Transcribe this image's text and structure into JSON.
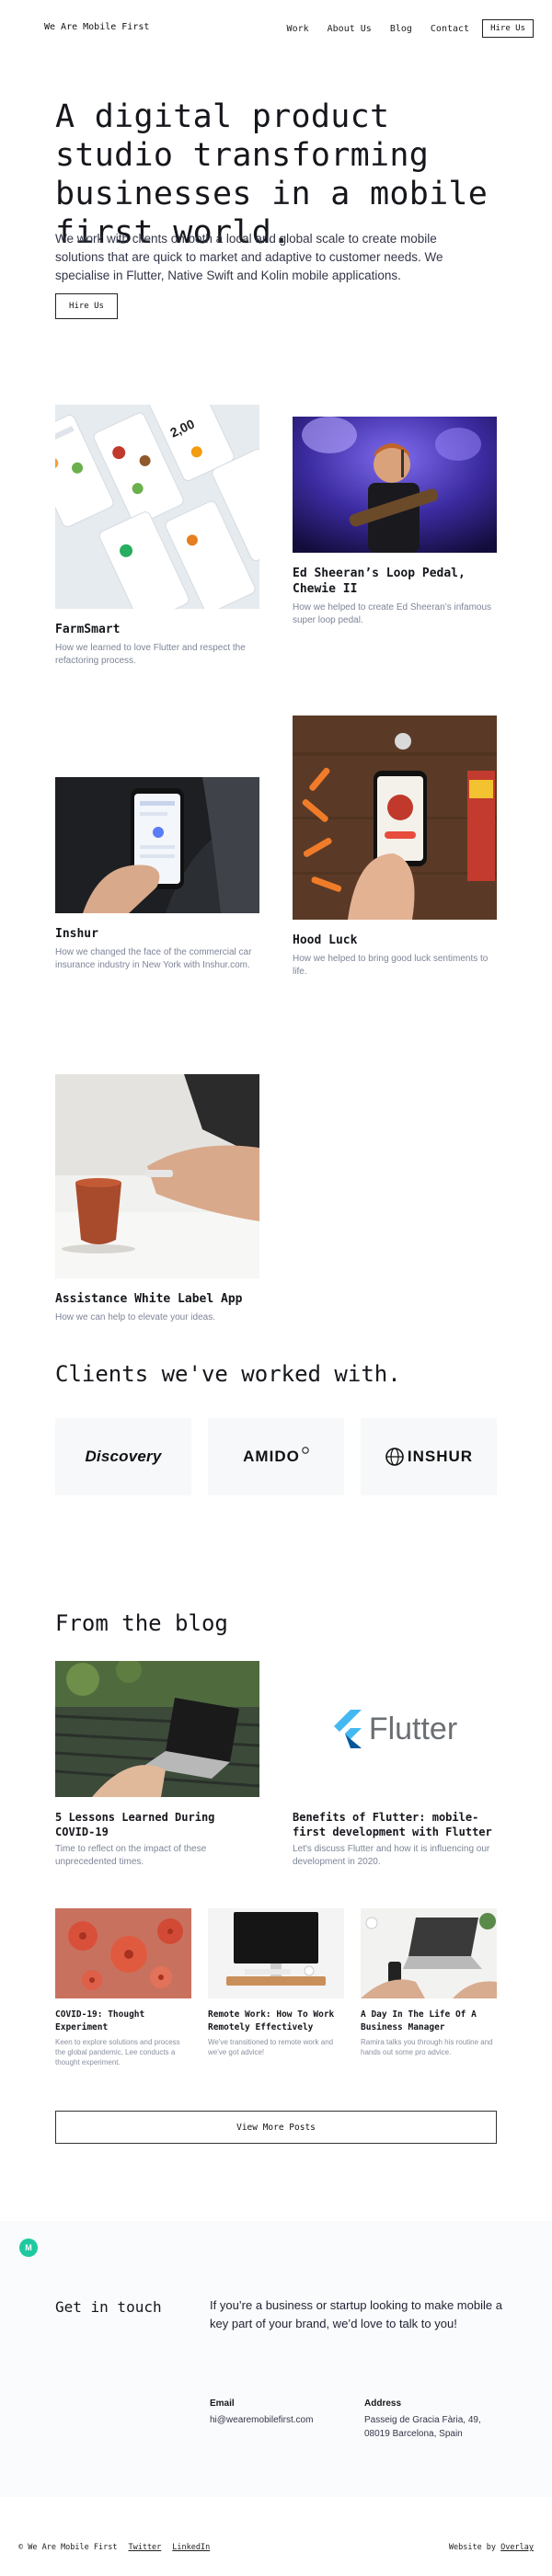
{
  "header": {
    "brand": "We Are Mobile First",
    "nav": [
      "Work",
      "About Us",
      "Blog",
      "Contact"
    ],
    "hire_label": "Hire Us"
  },
  "hero": {
    "title": "A digital product studio transforming businesses in a mobile first world.",
    "text": "We work with clients on both a local and global scale to create mobile solutions that are quick to market and adaptive to customer needs. We specialise in Flutter, Native Swift and Kolin mobile applications.",
    "button": "Hire Us"
  },
  "projects": [
    {
      "title": "FarmSmart",
      "desc": "How we learned to love Flutter and respect the refactoring process."
    },
    {
      "title": "Ed Sheeran’s Loop Pedal, Chewie II",
      "desc": "How we helped to create Ed Sheeran’s infamous super loop pedal."
    },
    {
      "title": "Inshur",
      "desc": "How we changed the face of the commercial car insurance industry in New York with Inshur.com."
    },
    {
      "title": "Hood Luck",
      "desc": "How we helped to bring good luck sentiments to life."
    },
    {
      "title": "Assistance White Label App",
      "desc": "How we can help to elevate your ideas."
    }
  ],
  "clients": {
    "heading": "Clients we've worked with.",
    "logos": [
      "Discovery",
      "AMIDO",
      "INSHUR"
    ]
  },
  "blog": {
    "heading": "From the blog",
    "featured": [
      {
        "title": "5 Lessons Learned During COVID-19",
        "desc": "Time to reflect on the impact of these unprecedented times."
      },
      {
        "title": "Benefits of Flutter: mobile-first development with Flutter",
        "desc": "Let's discuss Flutter and how it is influencing our development in 2020.",
        "logo_text": "Flutter"
      }
    ],
    "posts": [
      {
        "title": "COVID-19: Thought Experiment",
        "desc": "Keen to explore solutions and process the global pandemic, Lee conducts a thought experiment."
      },
      {
        "title": "Remote Work: How To Work Remotely Effectively",
        "desc": "We've transitioned to remote work and we've got advice!"
      },
      {
        "title": "A Day In The Life Of A Business Manager",
        "desc": "Ramira talks you through his routine and hands out some pro advice."
      }
    ],
    "more_label": "View More Posts"
  },
  "contact": {
    "badge": "M",
    "heading": "Get in touch",
    "text": "If you’re a business or startup looking to make mobile a key part of your brand, we’d love to talk to you!",
    "email_label": "Email",
    "email": "hi@wearemobilefirst.com",
    "address_label": "Address",
    "address_line1": "Passeig de Gracia Fària, 49,",
    "address_line2": "08019 Barcelona, Spain"
  },
  "footer": {
    "copyright": "© We Are Mobile First",
    "links": [
      "Twitter",
      "LinkedIn"
    ],
    "credit_prefix": "Website by",
    "credit_link": "Overlay"
  },
  "colors": {
    "accent": "#1fc9a0",
    "text": "#15171c",
    "muted": "#7e8598",
    "flutter_blue": "#44b8f1"
  }
}
